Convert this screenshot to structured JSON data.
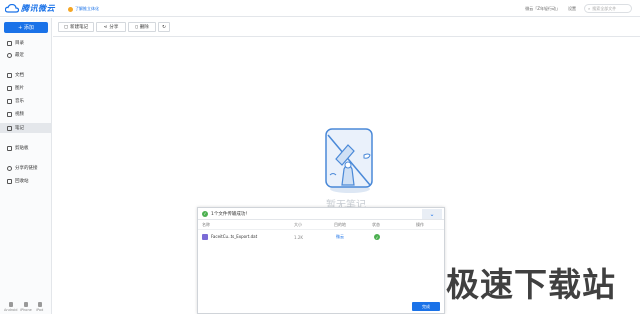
{
  "app": {
    "logo_text": "腾讯微云"
  },
  "header": {
    "promo": "了解推立体化",
    "user": "微云「Z年轻行动」",
    "settings": "设置",
    "search_placeholder": "搜索全部文件"
  },
  "sidebar": {
    "upload_label": "+ 添加",
    "items": [
      {
        "label": "目录"
      },
      {
        "label": "最近"
      },
      {
        "label": "文档"
      },
      {
        "label": "图片"
      },
      {
        "label": "音乐"
      },
      {
        "label": "视频"
      },
      {
        "label": "笔记"
      },
      {
        "label": "剪贴板"
      },
      {
        "label": "分享的链接"
      },
      {
        "label": "回收站"
      }
    ],
    "devices": [
      "Android",
      "iPhone",
      "iPad"
    ]
  },
  "toolbar": {
    "new_note": "新建笔记",
    "share": "分享",
    "delete": "删除"
  },
  "empty_state": {
    "text": "暂无笔记"
  },
  "transfer_panel": {
    "title": "1个文件传输成功！",
    "columns": [
      "名称",
      "大小",
      "目的地",
      "状态",
      "操作"
    ],
    "rows": [
      {
        "name": "FaceitCu..ts_Export.dat",
        "size": "1.2K",
        "dest": "微云",
        "status": "ok"
      }
    ],
    "done_button": "完成"
  },
  "watermark": "极速下载站",
  "colors": {
    "accent": "#1a72e8",
    "success": "#4cb050"
  }
}
